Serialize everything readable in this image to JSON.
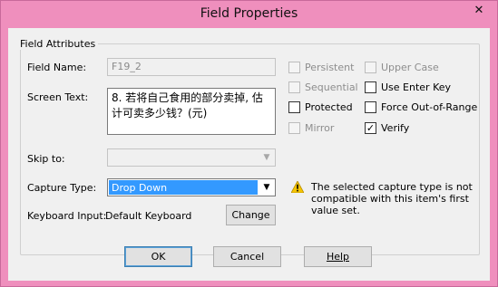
{
  "window": {
    "title": "Field Properties",
    "close_glyph": "✕"
  },
  "group": {
    "label": "Field Attributes"
  },
  "field_name": {
    "label": "Field Name:",
    "value": "F19_2"
  },
  "screen_text": {
    "label": "Screen Text:",
    "value": "8. 若将自己食用的部分卖掉, 估计可卖多少钱？(元)"
  },
  "skip_to": {
    "label": "Skip to:",
    "value": ""
  },
  "capture_type": {
    "label": "Capture Type:",
    "value": "Drop Down"
  },
  "keyboard_input": {
    "label": "Keyboard Input:",
    "value": "Default Keyboard"
  },
  "change_button": {
    "label": "Change"
  },
  "checkboxes": {
    "persistent": {
      "label": "Persistent",
      "checked": false,
      "enabled": false
    },
    "upper_case": {
      "label": "Upper Case",
      "checked": false,
      "enabled": false
    },
    "sequential": {
      "label": "Sequential",
      "checked": false,
      "enabled": false
    },
    "use_enter_key": {
      "label": "Use Enter Key",
      "checked": false,
      "enabled": true
    },
    "protected": {
      "label": "Protected",
      "checked": false,
      "enabled": true
    },
    "force_out_of_range": {
      "label": "Force Out-of-Range",
      "checked": false,
      "enabled": true
    },
    "mirror": {
      "label": "Mirror",
      "checked": false,
      "enabled": false
    },
    "verify": {
      "label": "Verify",
      "checked": true,
      "enabled": true
    }
  },
  "warning": {
    "icon": "warning-icon",
    "text": "The selected capture type is not compatible with this item's first value set."
  },
  "buttons": {
    "ok": "OK",
    "cancel": "Cancel",
    "help": "Help"
  },
  "colors": {
    "titlebar": "#ef8fbd",
    "selection": "#3399ff",
    "dialog_bg": "#f0f0f0"
  }
}
